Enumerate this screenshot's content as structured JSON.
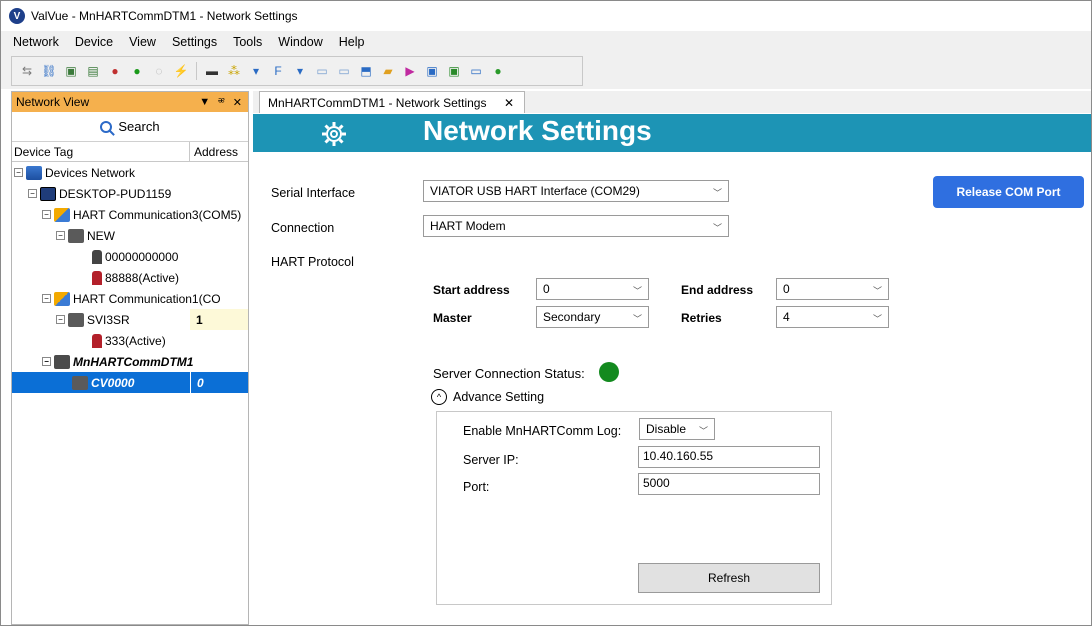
{
  "window": {
    "title": "ValVue - MnHARTCommDTM1 - Network Settings",
    "app_icon": "valvue-logo-icon"
  },
  "menu": [
    "Network",
    "Device",
    "View",
    "Settings",
    "Tools",
    "Window",
    "Help"
  ],
  "toolbar": {
    "icons": [
      "connect-icon",
      "network-icon",
      "device-icon",
      "device-add-icon",
      "param-icon",
      "online-icon",
      "offline-icon",
      "disconnect-icon",
      "io-icon",
      "bus-icon",
      "filter-icon",
      "upload-icon",
      "download-icon",
      "compare-icon",
      "folder-icon",
      "export-icon",
      "scan-icon",
      "report-icon",
      "monitor-icon",
      "help-icon"
    ]
  },
  "left_pane": {
    "title": "Network View",
    "search_label": "Search",
    "col_device_tag": "Device Tag",
    "col_address": "Address",
    "tree": [
      {
        "label": "Devices Network",
        "level": 0,
        "icon": "network-icon"
      },
      {
        "label": "DESKTOP-PUD1159",
        "level": 1,
        "icon": "computer-icon"
      },
      {
        "label": "HART Communication3(COM5)",
        "level": 2,
        "icon": "hart-icon"
      },
      {
        "label": "NEW",
        "level": 3,
        "icon": "device-icon"
      },
      {
        "label": "00000000000",
        "level": 4,
        "icon": "positioner-icon"
      },
      {
        "label": "88888(Active)",
        "level": 4,
        "icon": "positioner-icon"
      },
      {
        "label": "HART  Communication1(CO",
        "level": 2,
        "icon": "hart-icon"
      },
      {
        "label": "SVI3SR",
        "level": 3,
        "icon": "device-icon",
        "address": "1"
      },
      {
        "label": "333(Active)",
        "level": 4,
        "icon": "positioner-icon"
      },
      {
        "label": "MnHARTCommDTM1",
        "level": 2,
        "icon": "dtm-icon"
      },
      {
        "label": "CV0000",
        "level": 3,
        "icon": "device-icon",
        "address": "0",
        "selected": true
      }
    ]
  },
  "doc_tab": {
    "label": "MnHARTCommDTM1 - Network Settings",
    "close": "✕"
  },
  "banner": {
    "title": "Network Settings",
    "icon": "gear-icon",
    "color": "#1d94b5"
  },
  "form": {
    "serial_interface_label": "Serial Interface",
    "serial_interface_value": "VIATOR USB HART Interface (COM29)",
    "connection_label": "Connection",
    "connection_value": "HART Modem",
    "hart_protocol_label": "HART Protocol",
    "start_address_label": "Start address",
    "start_address_value": "0",
    "end_address_label": "End address",
    "end_address_value": "0",
    "master_label": "Master",
    "master_value": "Secondary",
    "retries_label": "Retries",
    "retries_value": "4",
    "release_button": "Release COM Port",
    "server_status_label": "Server Connection Status:",
    "server_status_color": "#138a1f",
    "advance_label": "Advance Setting",
    "log_label": "Enable MnHARTComm Log:",
    "log_value": "Disable",
    "server_ip_label": "Server IP:",
    "server_ip_value": "10.40.160.55",
    "port_label": "Port:",
    "port_value": "5000",
    "refresh_button": "Refresh"
  }
}
